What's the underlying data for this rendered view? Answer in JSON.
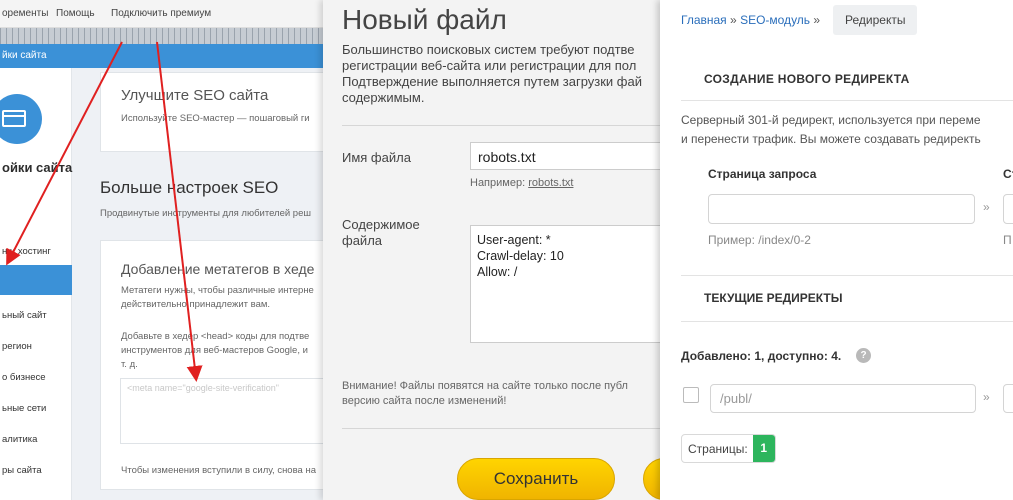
{
  "left_panel": {
    "topmenu": {
      "item1": "оременты",
      "item2": "Помощь",
      "item3": "Подключить премиум"
    },
    "bluebar": "йки сайта",
    "sidebar": {
      "title": "ойки сайта",
      "items": [
        "н и хостинг",
        "",
        "ьный сайт",
        "регион",
        "о бизнесе",
        "ьные сети",
        "алитика",
        "ры сайта"
      ],
      "active_index": 1
    },
    "card1": {
      "title": "Улучшите SEO сайта",
      "subtitle": "Используйте SEO-мастер — пошаговый ги"
    },
    "section_title": "Больше настроек SEO",
    "section_subtitle": "Продвинутые инструменты для любителей реш",
    "card2": {
      "title": "Добавление метатегов в хеде",
      "text": [
        "Метатеги нужны, чтобы различные интерне",
        "действительно принадлежит вам."
      ],
      "text2": [
        "Добавьте в хедер <head> коды для подтве",
        "инструментов для веб-мастеров Google, и",
        "т. д."
      ],
      "textarea_value": "<meta name=\"google-site-verification\" ",
      "footer": "Чтобы изменения вступили в силу, снова на"
    },
    "arrow_color": "#e02020"
  },
  "middle_panel": {
    "title": "Новый файл",
    "description": [
      "Большинство поисковых систем требуют подтве",
      "регистрации веб-сайта или регистрации для пол",
      "Подтверждение выполняется путем загрузки фай",
      "содержимым."
    ],
    "filename_label": "Имя файла",
    "filename_value": "robots.txt",
    "hint_prefix": "Например: ",
    "hint_example": "robots.txt",
    "content_label": [
      "Содержимое",
      "файла"
    ],
    "content_lines": [
      "User-agent: *",
      "Crawl-delay: 10",
      "Allow: /"
    ],
    "note": [
      "Внимание! Файлы появятся на сайте только после публ",
      "версию сайта после изменений!"
    ],
    "save_label": "Сохранить",
    "button_color": "#ffd400"
  },
  "right_panel": {
    "breadcrumbs": {
      "home": "Главная",
      "separator": "»",
      "seo": "SEO-модуль",
      "current": "Редиректы"
    },
    "create_title": "СОЗДАНИЕ НОВОГО РЕДИРЕКТА",
    "description": [
      "Серверный 301-й редирект, используется при переме",
      "и перенести трафик. Вы можете создавать редиректь"
    ],
    "request_label": "Страница запроса",
    "target_label": "Ст",
    "arrow_glyph": "»",
    "request_example": "Пример: /index/0-2",
    "target_example": "П",
    "current_title": "ТЕКУЩИЕ РЕДИРЕКТЫ",
    "counts": "Добавлено: 1, доступно: 4.",
    "help": "?",
    "row_placeholder": "/publ/",
    "pages_label": "Страницы:",
    "page_number": "1",
    "page_color": "#2db55d",
    "link_color": "#2a6ebb"
  }
}
